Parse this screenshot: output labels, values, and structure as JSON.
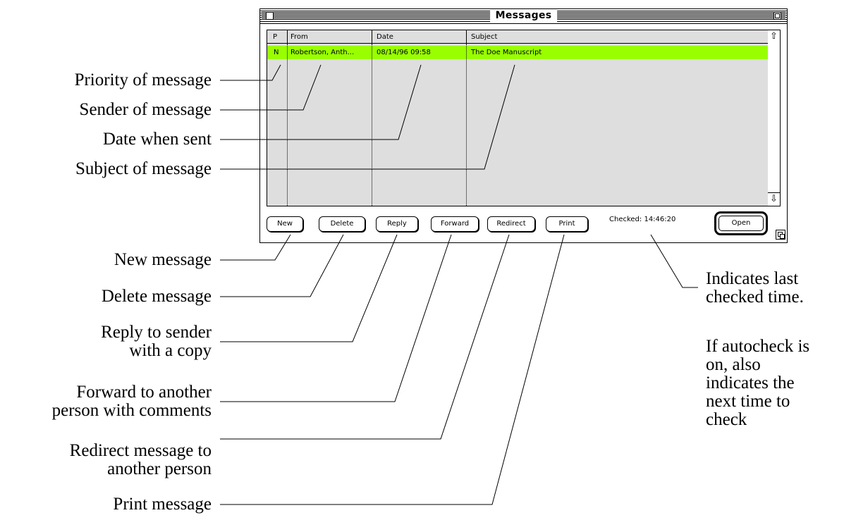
{
  "window": {
    "title": "Messages"
  },
  "columns": [
    "P",
    "From",
    "Date",
    "Subject"
  ],
  "rows": [
    {
      "priority": "N",
      "from": "Robertson, Anth...",
      "date": "08/14/96 09:58",
      "subject": "The Doe Manuscript"
    }
  ],
  "buttons": {
    "new": "New",
    "delete": "Delete",
    "reply": "Reply",
    "forward": "Forward",
    "redirect": "Redirect",
    "print": "Print",
    "open": "Open"
  },
  "status": {
    "checked": "Checked: 14:46:20"
  },
  "annotations": {
    "priority": "Priority of message",
    "sender": "Sender of message",
    "date": "Date when sent",
    "subject": "Subject of message",
    "new": "New message",
    "delete": "Delete message",
    "reply_1": "Reply to sender",
    "reply_2": "with a copy",
    "forward_1": "Forward to another",
    "forward_2": "person with comments",
    "redirect_1": "Redirect message to",
    "redirect_2": "another person",
    "print": "Print message",
    "checked_1": "Indicates last",
    "checked_2": "checked time.",
    "auto_1": "If autocheck is",
    "auto_2": "on, also",
    "auto_3": "indicates the",
    "auto_4": "next time to",
    "auto_5": "check"
  },
  "colors": {
    "selected_row": "#99ff00",
    "list_background": "#dedede"
  }
}
